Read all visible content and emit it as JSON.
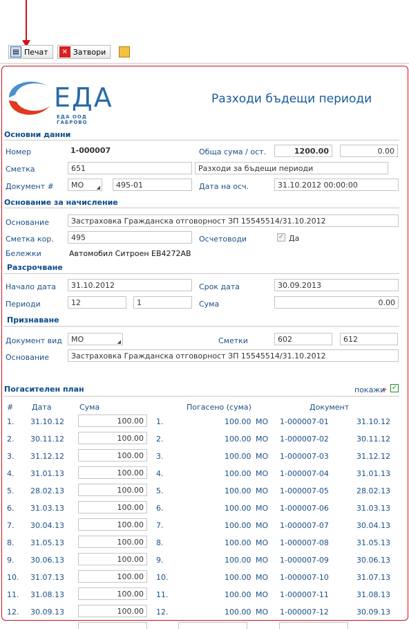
{
  "toolbar": {
    "print_label": "Печат",
    "close_label": "Затвори"
  },
  "header": {
    "logo_text": "ЕДА",
    "logo_sub": "ЕДА ООД ГАБРОВО",
    "title": "Разходи бъдещи периоди"
  },
  "basic": {
    "section": "Основни данни",
    "number_label": "Номер",
    "number": "1-000007",
    "total_label": "Обща сума / ост.",
    "total": "1200.00",
    "remaining": "0.00",
    "account_label": "Сметка",
    "account": "651",
    "account_name": "Разходи за бъдещи периоди",
    "doc_label": "Документ #",
    "doc_type": "МО",
    "doc_no": "495-01",
    "date_label": "Дата на осч.",
    "date": "31.10.2012 00:00:00"
  },
  "accrual": {
    "section": "Основание за начисление",
    "basis_label": "Основание",
    "basis": "Застраховка Гражданска отговорност ЗП 15545514/31.10.2012",
    "corr_label": "Сметка кор.",
    "corr": "495",
    "posted_label": "Осчетоводи",
    "posted_value": "Да",
    "notes_label": "Бележки",
    "notes": "Автомобил Ситроен ЕВ4272АВ"
  },
  "schedule": {
    "section": "Разсрочване",
    "start_label": "Начало дата",
    "start": "31.10.2012",
    "end_label": "Срок дата",
    "end": "30.09.2013",
    "periods_label": "Периоди",
    "periods": "12",
    "periods2": "1",
    "sum_label": "Сума",
    "sum": "0.00"
  },
  "recognition": {
    "section": "Признаване",
    "doc_type_label": "Документ вид",
    "doc_type": "МО",
    "accounts_label": "Сметки",
    "acc1": "602",
    "acc2": "612",
    "basis_label": "Основание",
    "basis": "Застраховка Гражданска отговорност ЗП 15545514/31.10.2012"
  },
  "plan": {
    "section": "Погасителен план",
    "show_label": "покажи",
    "show_arrow": "»",
    "headers": {
      "num": "#",
      "date": "Дата",
      "sum": "Сума",
      "paid": "Погасено (сума)",
      "doc": "Документ"
    },
    "rows": [
      {
        "n": "1.",
        "date": "31.10.12",
        "amount": "100.00",
        "paid": "100.00",
        "type": "МО",
        "doc": "1-000007-01",
        "doc_date": "31.10.12"
      },
      {
        "n": "2.",
        "date": "30.11.12",
        "amount": "100.00",
        "paid": "100.00",
        "type": "МО",
        "doc": "1-000007-02",
        "doc_date": "30.11.12"
      },
      {
        "n": "3.",
        "date": "31.12.12",
        "amount": "100.00",
        "paid": "100.00",
        "type": "МО",
        "doc": "1-000007-03",
        "doc_date": "31.12.12"
      },
      {
        "n": "4.",
        "date": "31.01.13",
        "amount": "100.00",
        "paid": "100.00",
        "type": "МО",
        "doc": "1-000007-04",
        "doc_date": "31.01.13"
      },
      {
        "n": "5.",
        "date": "28.02.13",
        "amount": "100.00",
        "paid": "100.00",
        "type": "МО",
        "doc": "1-000007-05",
        "doc_date": "28.02.13"
      },
      {
        "n": "6.",
        "date": "31.03.13",
        "amount": "100.00",
        "paid": "100.00",
        "type": "МО",
        "doc": "1-000007-06",
        "doc_date": "31.03.13"
      },
      {
        "n": "7.",
        "date": "30.04.13",
        "amount": "100.00",
        "paid": "100.00",
        "type": "МО",
        "doc": "1-000007-07",
        "doc_date": "30.04.13"
      },
      {
        "n": "8.",
        "date": "31.05.13",
        "amount": "100.00",
        "paid": "100.00",
        "type": "МО",
        "doc": "1-000007-08",
        "doc_date": "31.05.13"
      },
      {
        "n": "9.",
        "date": "30.06.13",
        "amount": "100.00",
        "paid": "100.00",
        "type": "МО",
        "doc": "1-000007-09",
        "doc_date": "30.06.13"
      },
      {
        "n": "10.",
        "date": "31.07.13",
        "amount": "100.00",
        "paid": "100.00",
        "type": "МО",
        "doc": "1-000007-10",
        "doc_date": "31.07.13"
      },
      {
        "n": "11.",
        "date": "31.08.13",
        "amount": "100.00",
        "paid": "100.00",
        "type": "МО",
        "doc": "1-000007-11",
        "doc_date": "31.08.13"
      },
      {
        "n": "12.",
        "date": "30.09.13",
        "amount": "100.00",
        "paid": "100.00",
        "type": "МО",
        "doc": "1-000007-12",
        "doc_date": "30.09.13"
      }
    ]
  }
}
